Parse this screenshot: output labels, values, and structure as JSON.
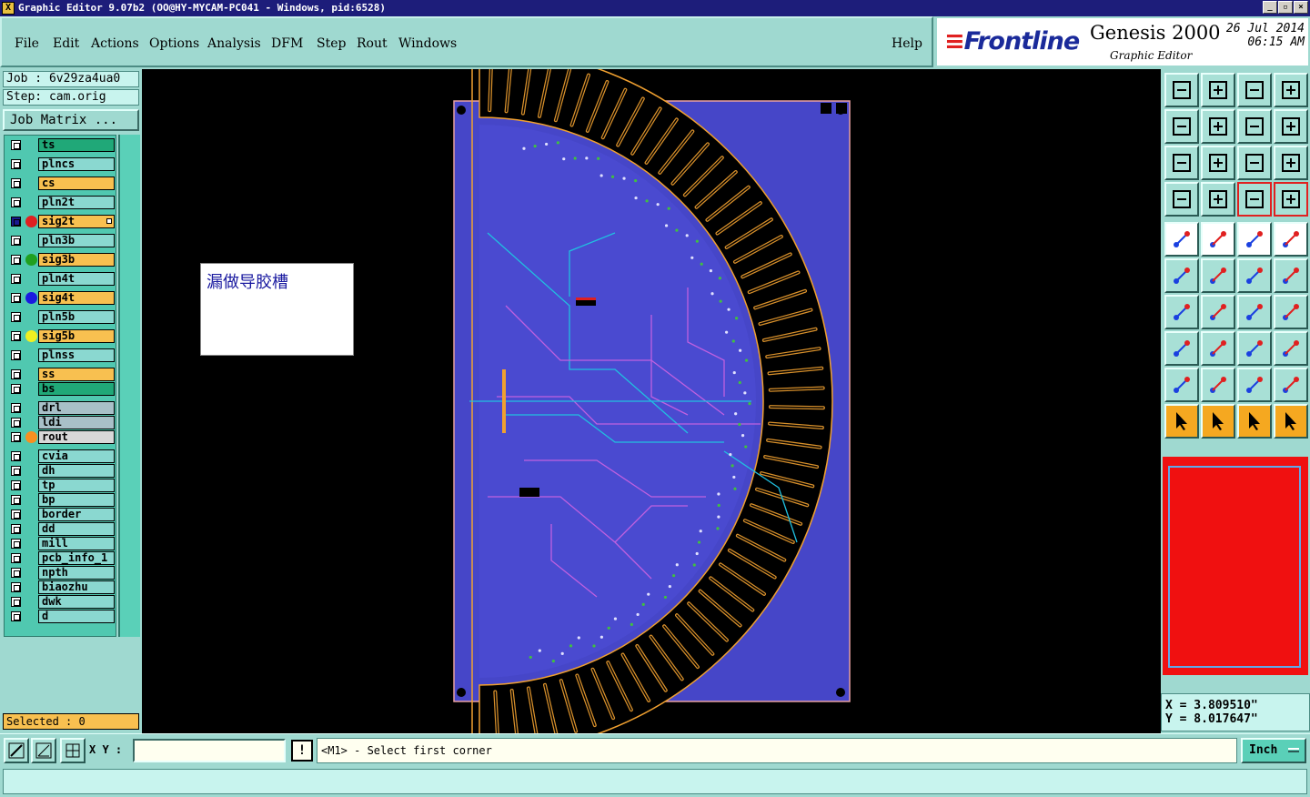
{
  "window": {
    "title": "Graphic Editor 9.07b2 (OO@HY-MYCAM-PC041 - Windows, pid:6528)",
    "app_icon": "X"
  },
  "menu": {
    "items": [
      "File",
      "Edit",
      "Actions",
      "Options",
      "Analysis",
      "DFM",
      "Step",
      "Rout",
      "Windows"
    ],
    "help": "Help"
  },
  "brand": {
    "logo": "Frontline",
    "product": "Genesis 2000",
    "subtitle": "Graphic Editor",
    "date": "26 Jul 2014",
    "time": "06:15 AM"
  },
  "job": {
    "job_label": "Job : 6v29za4ua0",
    "step_label": "Step: cam.orig",
    "matrix_button": "Job Matrix ..."
  },
  "layers": [
    {
      "name": "ts",
      "color": "#20a878",
      "dot": ""
    },
    {
      "name": "plncs",
      "color": "#8ad8d0",
      "dot": ""
    },
    {
      "name": "cs",
      "color": "#f8c050",
      "dot": ""
    },
    {
      "name": "pln2t",
      "color": "#8ad8d0",
      "dot": ""
    },
    {
      "name": "sig2t",
      "color": "#f8c050",
      "dot": "#e02020",
      "active": true
    },
    {
      "name": "pln3b",
      "color": "#8ad8d0",
      "dot": ""
    },
    {
      "name": "sig3b",
      "color": "#f8c050",
      "dot": "#20a020"
    },
    {
      "name": "pln4t",
      "color": "#8ad8d0",
      "dot": ""
    },
    {
      "name": "sig4t",
      "color": "#f8c050",
      "dot": "#1a1ae0"
    },
    {
      "name": "pln5b",
      "color": "#8ad8d0",
      "dot": ""
    },
    {
      "name": "sig5b",
      "color": "#f8c050",
      "dot": "#f0f020"
    },
    {
      "name": "plnss",
      "color": "#8ad8d0",
      "dot": ""
    },
    {
      "name": "ss",
      "color": "#f8c050",
      "dot": ""
    },
    {
      "name": "bs",
      "color": "#20a878",
      "dot": ""
    },
    {
      "name": "drl",
      "color": "#a8c0c8",
      "dot": ""
    },
    {
      "name": "ldi",
      "color": "#a8c0c8",
      "dot": ""
    },
    {
      "name": "rout",
      "color": "#d8d8d8",
      "dot": "#f89020"
    },
    {
      "name": "cvia",
      "color": "#8ad8d0",
      "dot": ""
    },
    {
      "name": "dh",
      "color": "#8ad8d0",
      "dot": ""
    },
    {
      "name": "tp",
      "color": "#8ad8d0",
      "dot": ""
    },
    {
      "name": "bp",
      "color": "#8ad8d0",
      "dot": ""
    },
    {
      "name": "border",
      "color": "#8ad8d0",
      "dot": ""
    },
    {
      "name": "dd",
      "color": "#8ad8d0",
      "dot": ""
    },
    {
      "name": "mill",
      "color": "#8ad8d0",
      "dot": ""
    },
    {
      "name": "pcb_info_1",
      "color": "#8ad8d0",
      "dot": ""
    },
    {
      "name": "npth",
      "color": "#8ad8d0",
      "dot": ""
    },
    {
      "name": "biaozhu",
      "color": "#8ad8d0",
      "dot": ""
    },
    {
      "name": "dwk",
      "color": "#8ad8d0",
      "dot": ""
    },
    {
      "name": "d",
      "color": "#8ad8d0",
      "dot": ""
    }
  ],
  "selected": "Selected : 0",
  "canvas": {
    "note_text": "漏做导胶槽",
    "board_color": "#4646c8",
    "rout_color": "#f0a030"
  },
  "tools": [
    "open-icon",
    "save-icon",
    "home-icon",
    "split-view-icon",
    "zoom-back-icon",
    "zoom-forward-icon",
    "zoom-fit-icon",
    "snap-icon",
    "pan-icon",
    "center-icon",
    "one-to-two-icon",
    "help-icon",
    "settings-icon",
    "grid-icon",
    "layer-red-icon",
    "layer-red-2-icon",
    "fill-icon",
    "polygon-icon",
    "ruler-icon",
    "point-icon",
    "connect-icon",
    "cross-icon",
    "line-icon",
    "line-2-icon",
    "angle-icon",
    "slash-icon",
    "arc-icon",
    "text-f-icon",
    "pad-icon",
    "minus-icon",
    "measure-icon",
    "blob-icon",
    "triangle-icon",
    "triangle-2-icon",
    "triangle-3-icon",
    "triangle-4-icon",
    "select-arrow-icon",
    "select-box-icon",
    "select-arrow-2-icon",
    "route-icon"
  ],
  "coords": {
    "x": "X = 3.809510\"",
    "y": "Y = 8.017647\""
  },
  "bottom": {
    "xy_label": "X Y :",
    "xy_value": "",
    "excl": "!",
    "prompt": "<M1> - Select first corner",
    "units": "Inch"
  }
}
